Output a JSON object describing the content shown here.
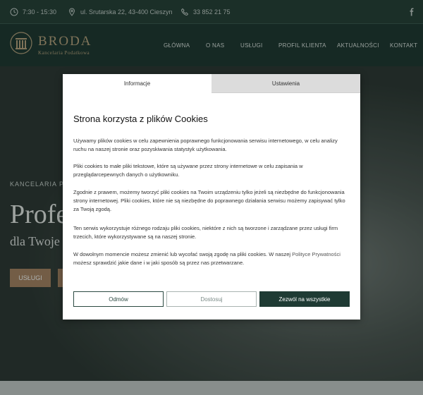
{
  "topbar": {
    "hours": "7:30 - 15:30",
    "address": "ul. Srutarska 22, 43-400 Cieszyn",
    "phone": "33 852 21 75",
    "social_icon": "facebook-icon"
  },
  "brand": {
    "name": "BRODA",
    "subtitle": "Kancelaria Podatkowa"
  },
  "nav": {
    "items": [
      "GŁÓWNA",
      "O NAS",
      "USŁUGI",
      "PROFIL KLIENTA",
      "AKTUALNOŚCI",
      "KONTAKT"
    ]
  },
  "hero": {
    "pretitle": "KANCELARIA PO",
    "title": "Profe",
    "subtitle": "dla Twoje",
    "button": "USŁUGI"
  },
  "cookie_modal": {
    "tabs": [
      "Informacje",
      "Ustawienia"
    ],
    "title": "Strona korzysta z plików Cookies",
    "paragraphs": [
      "Używamy plików cookies w celu zapewnienia poprawnego funkcjonowania serwisu internetowego, w celu analizy ruchu na naszej stronie oraz pozyskiwania statystyk użytkowania.",
      "Pliki cookies to małe pliki tekstowe, które są używane przez strony internetowe w celu zapisania w przeglądarcepewnych danych o użytkowniku.",
      "Zgodnie z prawem, możemy tworzyć pliki cookies na Twoim urządzeniu tylko jeżeli są niezbędne do funkcjonowania strony internetowej. Pliki cookies, które nie są niezbędne do poprawnego działania serwisu możemy zapisywać tylko za Twoją zgodą.",
      "Ten serwis wykorzystuje różnego rodzaju pliki cookies, niektóre z nich są tworzone i zarządzane przez usługi firm trzecich, które wykorzystywane są na naszej stronie."
    ],
    "last_paragraph_before": "W dowolnym momencie możesz zmienić lub wycofać swoją zgodę na pliki cookies. W naszej ",
    "privacy_link": "Polityce Prywatności",
    "last_paragraph_after": " możesz sprawdzić jakie dane i w jaki sposób są przez nas przetwarzane.",
    "buttons": {
      "decline": "Odmów",
      "confirm": "Dostosuj",
      "allow_all": "Zezwól na wszystkie"
    }
  },
  "colors": {
    "brand_green": "#1f3b34",
    "gold": "#b8a27c",
    "accent_button": "#a7805e"
  }
}
